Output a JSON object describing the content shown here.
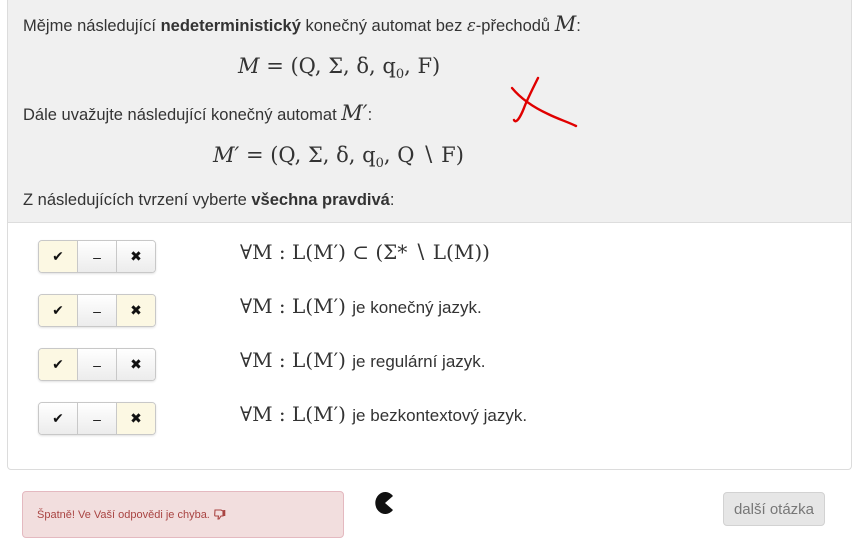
{
  "question": {
    "intro_prefix": "Mějme následující",
    "intro_bold": "nedeterministický",
    "intro_suffix": "konečný automat bez",
    "intro_eps": "ε",
    "intro_suffix2": "-přechodů",
    "intro_M": "M",
    "intro_colon": ":",
    "formula1_lhs": "M",
    "formula1_rhs": "= (Q, Σ, δ, q",
    "formula1_sub": "0",
    "formula1_end": ", F)",
    "second_prefix": "Dále uvažujte následující konečný automat",
    "second_M": "M′",
    "second_colon": ":",
    "formula2_lhs": "M′",
    "formula2_rhs": "= (Q, Σ, δ, q",
    "formula2_sub": "0",
    "formula2_end": ", Q ∖ F)",
    "instruction_prefix": "Z následujících tvrzení vyberte",
    "instruction_bold": "všechna pravdivá",
    "instruction_suffix": ":"
  },
  "buttons": {
    "true_glyph": "✔",
    "neutral_glyph": "–",
    "false_glyph": "✖"
  },
  "options": [
    {
      "math": "∀M : L(M′) ⊂ (Σ* ∖ L(M))",
      "text": "",
      "selected": "true"
    },
    {
      "math": "∀M : L(M′)",
      "text": "je konečný jazyk.",
      "selected": "both"
    },
    {
      "math": "∀M : L(M′)",
      "text": "je regulární jazyk.",
      "selected": "true"
    },
    {
      "math": "∀M : L(M′)",
      "text": "je bezkontextový jazyk.",
      "selected": "false"
    }
  ],
  "feedback": {
    "message": "Špatně! Ve Vaší odpovědi je chyba.",
    "icon": "thumbs-down-icon"
  },
  "next_button": {
    "label": "další otázka"
  },
  "colors": {
    "selected_bg": "#fcf8e3",
    "error_bg": "#f2dede",
    "error_text": "#a94442",
    "scribble": "#e00000"
  }
}
